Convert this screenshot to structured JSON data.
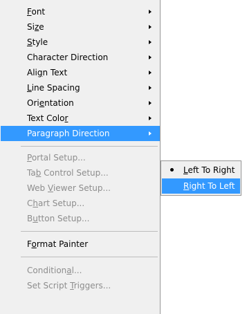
{
  "menu": {
    "items": [
      {
        "label_pre": "",
        "label_u": "F",
        "label_post": "ont",
        "submenu": true,
        "disabled": false
      },
      {
        "label_pre": "Si",
        "label_u": "z",
        "label_post": "e",
        "submenu": true,
        "disabled": false
      },
      {
        "label_pre": "",
        "label_u": "S",
        "label_post": "tyle",
        "submenu": true,
        "disabled": false
      },
      {
        "label_pre": "Character Direction",
        "label_u": "",
        "label_post": "",
        "submenu": true,
        "disabled": false
      },
      {
        "label_pre": "Ali",
        "label_u": "g",
        "label_post": "n Text",
        "submenu": true,
        "disabled": false
      },
      {
        "label_pre": "",
        "label_u": "L",
        "label_post": "ine Spacing",
        "submenu": true,
        "disabled": false
      },
      {
        "label_pre": "Ori",
        "label_u": "e",
        "label_post": "ntation",
        "submenu": true,
        "disabled": false
      },
      {
        "label_pre": "Text Colo",
        "label_u": "r",
        "label_post": "",
        "submenu": true,
        "disabled": false
      },
      {
        "label_pre": "Paragraph Direction",
        "label_u": "",
        "label_post": "",
        "submenu": true,
        "disabled": false,
        "highlighted": true
      },
      {
        "label_pre": "",
        "label_u": "P",
        "label_post": "ortal Setup...",
        "submenu": false,
        "disabled": true
      },
      {
        "label_pre": "Ta",
        "label_u": "b",
        "label_post": " Control Setup...",
        "submenu": false,
        "disabled": true
      },
      {
        "label_pre": "Web ",
        "label_u": "V",
        "label_post": "iewer Setup...",
        "submenu": false,
        "disabled": true
      },
      {
        "label_pre": "C",
        "label_u": "h",
        "label_post": "art Setup...",
        "submenu": false,
        "disabled": true
      },
      {
        "label_pre": "B",
        "label_u": "u",
        "label_post": "tton Setup...",
        "submenu": false,
        "disabled": true
      },
      {
        "label_pre": "F",
        "label_u": "o",
        "label_post": "rmat Painter",
        "submenu": false,
        "disabled": false
      },
      {
        "label_pre": "Condition",
        "label_u": "a",
        "label_post": "l...",
        "submenu": false,
        "disabled": true
      },
      {
        "label_pre": "Set Script ",
        "label_u": "T",
        "label_post": "riggers...",
        "submenu": false,
        "disabled": true
      }
    ]
  },
  "submenu": {
    "items": [
      {
        "label_pre": "",
        "label_u": "L",
        "label_post": "eft To Right",
        "checked": true
      },
      {
        "label_pre": "",
        "label_u": "R",
        "label_post": "ight To Left",
        "checked": false,
        "highlighted": true
      }
    ]
  },
  "colors": {
    "highlight": "#3399ff",
    "menu_bg": "#f0f0f0",
    "disabled_text": "#8d8d8d"
  }
}
